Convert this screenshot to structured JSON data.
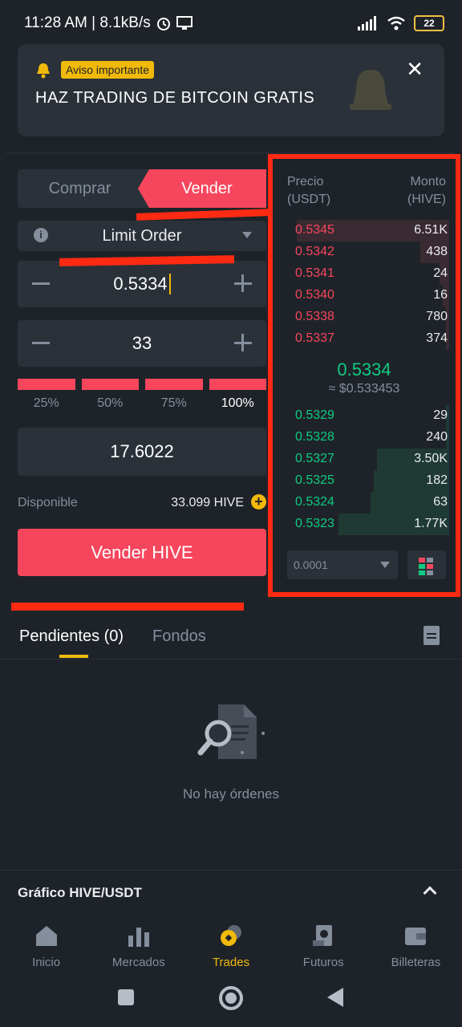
{
  "status_bar": {
    "time_speed": "11:28 AM | 8.1kB/s",
    "battery": "22"
  },
  "notice": {
    "badge": "Aviso importante",
    "headline": "HAZ TRADING DE BITCOIN GRATIS"
  },
  "trade": {
    "tab_buy": "Comprar",
    "tab_sell": "Vender",
    "order_type": "Limit Order",
    "price": "0.5334",
    "amount": "33",
    "percents": [
      "25%",
      "50%",
      "75%",
      "100%"
    ],
    "total": "17.6022",
    "available_label": "Disponible",
    "available_value": "33.099 HIVE",
    "sell_button": "Vender HIVE"
  },
  "orderbook": {
    "price_header": "Precio",
    "price_unit": "(USDT)",
    "amount_header": "Monto",
    "amount_unit": "(HIVE)",
    "asks": [
      {
        "price": "0.5345",
        "amount": "6.51K",
        "depth": 0.95
      },
      {
        "price": "0.5342",
        "amount": "438",
        "depth": 0.18
      },
      {
        "price": "0.5341",
        "amount": "24",
        "depth": 0.06
      },
      {
        "price": "0.5340",
        "amount": "16",
        "depth": 0.04
      },
      {
        "price": "0.5338",
        "amount": "780",
        "depth": 0.02
      },
      {
        "price": "0.5337",
        "amount": "374",
        "depth": 0.02
      }
    ],
    "mid_price": "0.5334",
    "mid_usd": "≈ $0.533453",
    "bids": [
      {
        "price": "0.5329",
        "amount": "29",
        "depth": 0.02
      },
      {
        "price": "0.5328",
        "amount": "240",
        "depth": 0.02
      },
      {
        "price": "0.5327",
        "amount": "3.50K",
        "depth": 0.45
      },
      {
        "price": "0.5325",
        "amount": "182",
        "depth": 0.47
      },
      {
        "price": "0.5324",
        "amount": "63",
        "depth": 0.49
      },
      {
        "price": "0.5323",
        "amount": "1.77K",
        "depth": 0.69
      }
    ],
    "precision": "0.0001"
  },
  "orders": {
    "tab_pending": "Pendientes (0)",
    "tab_funds": "Fondos",
    "empty": "No hay órdenes"
  },
  "chart_toggle": "Gráfico HIVE/USDT",
  "nav": [
    {
      "label": "Inicio",
      "icon": "home-icon"
    },
    {
      "label": "Mercados",
      "icon": "markets-icon"
    },
    {
      "label": "Trades",
      "icon": "trades-icon"
    },
    {
      "label": "Futuros",
      "icon": "futures-icon"
    },
    {
      "label": "Billeteras",
      "icon": "wallet-icon"
    }
  ],
  "colors": {
    "background": "#1e2329",
    "surface": "#2b3139",
    "sell": "#f6465d",
    "buy": "#0ecb81",
    "accent": "#f0b90b",
    "annotation": "#ff2a12"
  }
}
